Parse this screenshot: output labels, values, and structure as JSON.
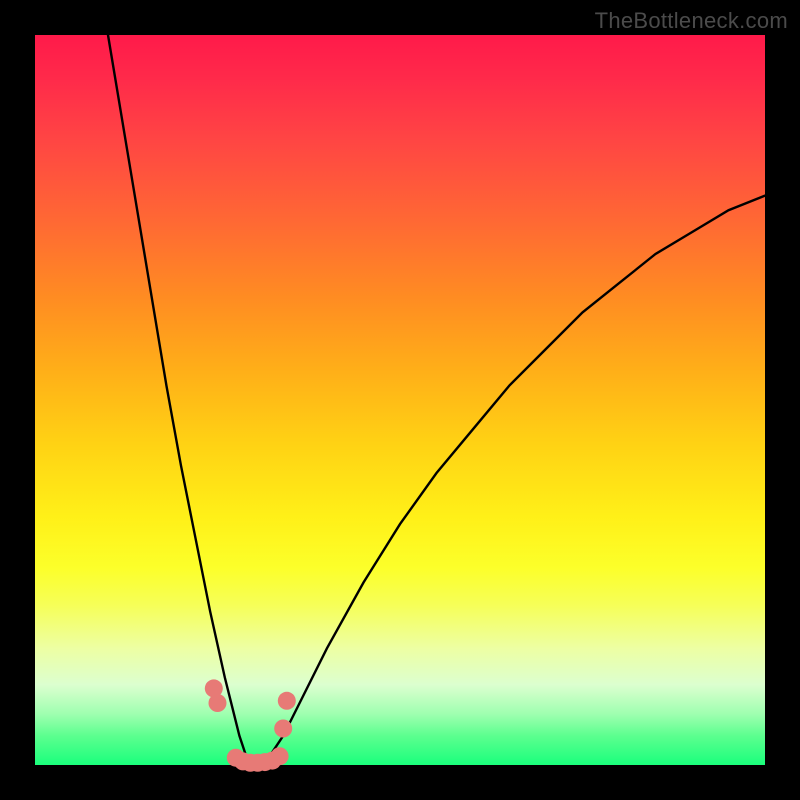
{
  "watermark": "TheBottleneck.com",
  "chart_data": {
    "type": "line",
    "title": "",
    "xlabel": "",
    "ylabel": "",
    "xlim": [
      0,
      100
    ],
    "ylim": [
      0,
      100
    ],
    "grid": false,
    "legend": false,
    "series": [
      {
        "name": "curve",
        "x": [
          10,
          12,
          14,
          16,
          18,
          20,
          22,
          24,
          26,
          27,
          28,
          29,
          30,
          31,
          32,
          34,
          36,
          40,
          45,
          50,
          55,
          60,
          65,
          70,
          75,
          80,
          85,
          90,
          95,
          100
        ],
        "values": [
          100,
          88,
          76,
          64,
          52,
          41,
          31,
          21,
          12,
          8,
          4,
          1,
          0,
          0,
          1,
          4,
          8,
          16,
          25,
          33,
          40,
          46,
          52,
          57,
          62,
          66,
          70,
          73,
          76,
          78
        ]
      }
    ],
    "annotations": [
      {
        "type": "markers",
        "shape": "dots",
        "color": "#e77a76",
        "points_x": [
          24.5,
          25.0,
          27.5,
          28.5,
          29.5,
          30.5,
          31.5,
          32.5,
          33.5,
          34.0,
          34.5
        ],
        "points_y": [
          10.5,
          8.5,
          1.0,
          0.5,
          0.3,
          0.3,
          0.4,
          0.6,
          1.2,
          5.0,
          8.8
        ]
      }
    ],
    "background_gradient": {
      "direction": "top-to-bottom",
      "stops": [
        {
          "pos": 0.0,
          "color": "#ff1a4a"
        },
        {
          "pos": 0.3,
          "color": "#ff6a33"
        },
        {
          "pos": 0.55,
          "color": "#ffd214"
        },
        {
          "pos": 0.75,
          "color": "#fcff2a"
        },
        {
          "pos": 0.9,
          "color": "#dcffcf"
        },
        {
          "pos": 1.0,
          "color": "#1aff7c"
        }
      ]
    }
  },
  "colors": {
    "curve_stroke": "#000000",
    "marker_fill": "#e77a76",
    "frame_bg": "#000000"
  }
}
